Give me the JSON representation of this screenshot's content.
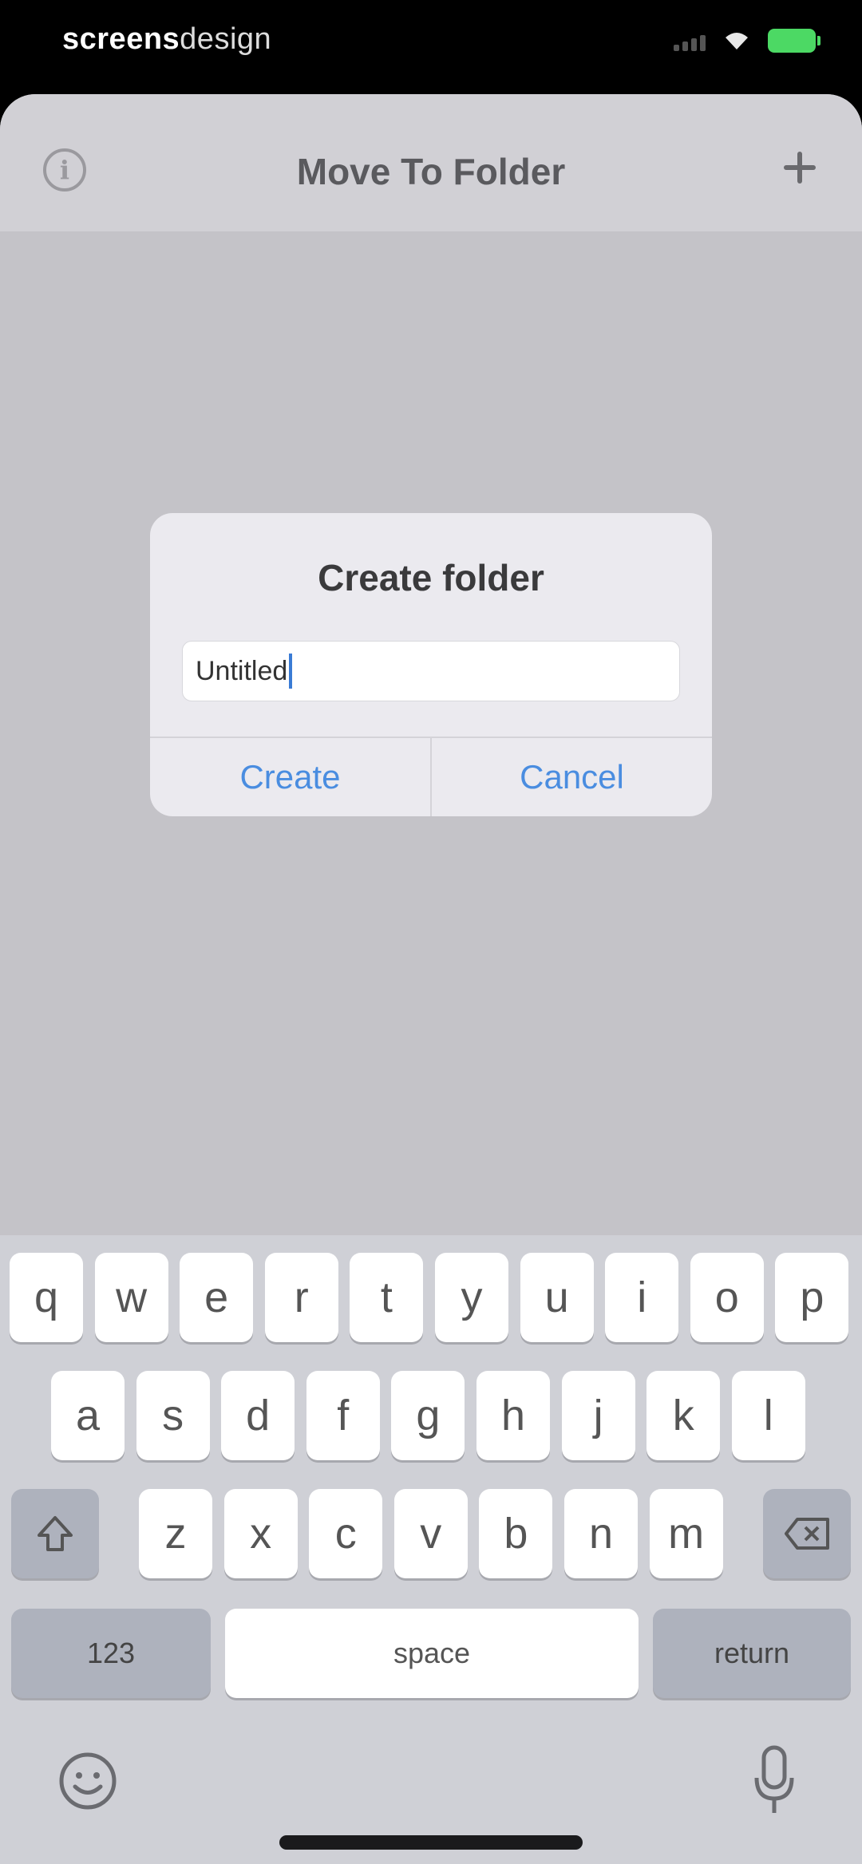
{
  "status_bar": {
    "carrier_bold": "screens",
    "carrier_light": "design",
    "battery_color": "#4cd964"
  },
  "header": {
    "title": "Move To Folder",
    "left_icon": "info-icon",
    "right_icon": "plus-icon"
  },
  "dialog": {
    "title": "Create folder",
    "input_value": "Untitled",
    "create_label": "Create",
    "cancel_label": "Cancel",
    "button_color": "#4a8de0"
  },
  "keyboard": {
    "row1": [
      "q",
      "w",
      "e",
      "r",
      "t",
      "y",
      "u",
      "i",
      "o",
      "p"
    ],
    "row2": [
      "a",
      "s",
      "d",
      "f",
      "g",
      "h",
      "j",
      "k",
      "l"
    ],
    "row3": [
      "z",
      "x",
      "c",
      "v",
      "b",
      "n",
      "m"
    ],
    "shift_icon": "shift-icon",
    "delete_icon": "backspace-icon",
    "numbers_label": "123",
    "space_label": "space",
    "return_label": "return",
    "emoji_icon": "emoji-icon",
    "mic_icon": "microphone-icon"
  }
}
